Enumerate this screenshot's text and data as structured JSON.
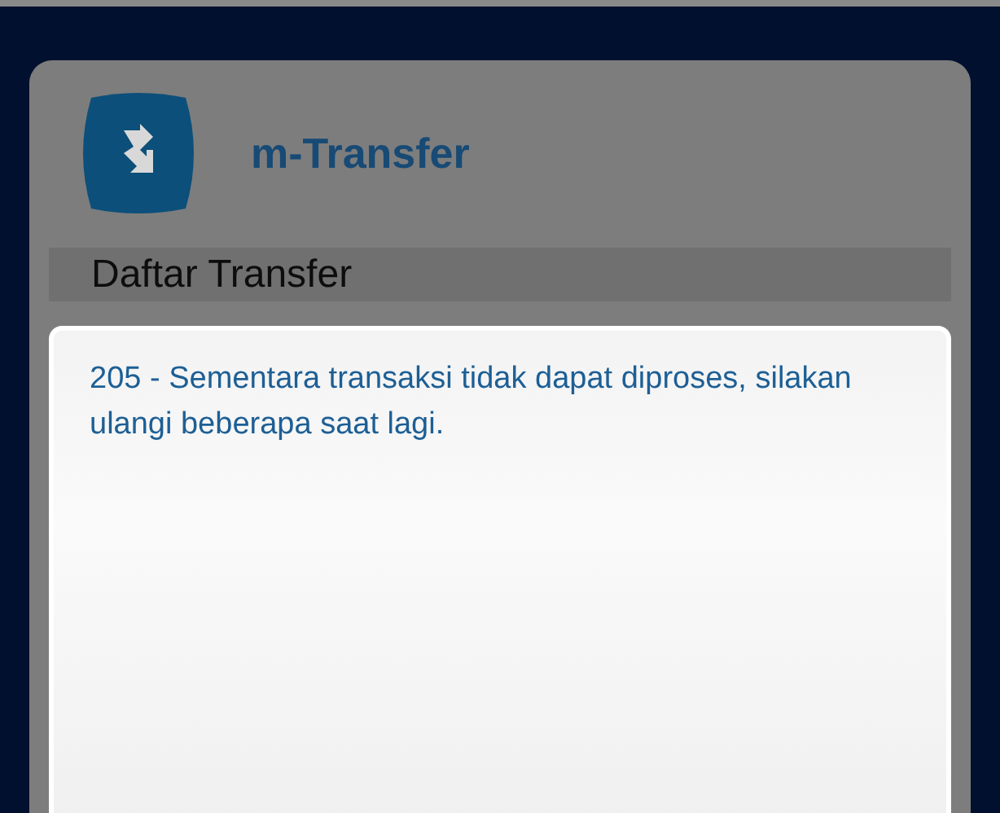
{
  "app": {
    "title": "m-Transfer"
  },
  "section": {
    "title": "Daftar Transfer"
  },
  "dialog": {
    "message": "205 - Sementara transaksi tidak dapat diproses, silakan ulangi beberapa saat lagi."
  }
}
